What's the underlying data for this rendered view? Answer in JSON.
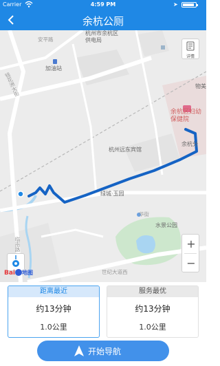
{
  "status_bar": {
    "carrier": "Carrier",
    "time": "4:59 PM",
    "battery_level": 0.9
  },
  "nav_bar": {
    "title": "余杭公厕"
  },
  "map": {
    "labels": {
      "anping_road": "安平路",
      "power_bureau": "杭州市余杭区\n供电局",
      "gas_station": "加油站",
      "zhonghua_street": "钱花洲大街",
      "hospital": "余杭区妇幼\n保健院",
      "hotel": "杭州远东宾馆",
      "community": "绿城·玉园",
      "garden": "水景公园",
      "shihua_road": "华街",
      "century_avenue": "世纪大道西",
      "south_road": "临南路",
      "wuzhong": "物美",
      "yuhangfen": "余杭分"
    },
    "detail_button": "详情",
    "zoom_in": "+",
    "zoom_out": "−",
    "attribution": {
      "brand": "Bai",
      "map_word": "地图"
    }
  },
  "route_options": [
    {
      "header": "距离最近",
      "duration": "约13分钟",
      "distance": "1.0公里",
      "active": true
    },
    {
      "header": "服务最优",
      "duration": "约13分钟",
      "distance": "1.0公里",
      "active": false
    }
  ],
  "start_button": {
    "label": "开始导航"
  },
  "colors": {
    "primary": "#1f88e5",
    "route": "#1563c4",
    "button": "#4291ea"
  }
}
